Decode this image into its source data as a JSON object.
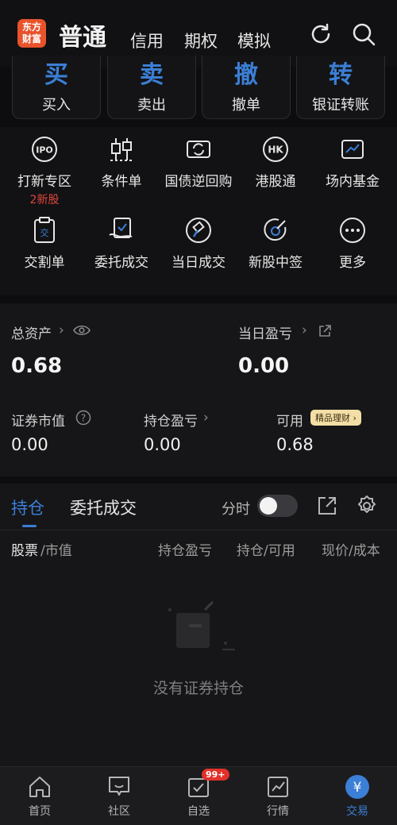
{
  "header": {
    "logo_text": "东方财富",
    "tabs": [
      "普通",
      "信用",
      "期权",
      "模拟"
    ]
  },
  "quick_actions": [
    {
      "glyph": "买",
      "label": "买入"
    },
    {
      "glyph": "卖",
      "label": "卖出"
    },
    {
      "glyph": "撤",
      "label": "撤单"
    },
    {
      "glyph": "转",
      "label": "银证转账"
    }
  ],
  "grid": [
    {
      "label": "打新专区",
      "badge": "2新股",
      "icon": "ipo-icon",
      "icon_text": "IPO"
    },
    {
      "label": "条件单",
      "icon": "condition-order-icon"
    },
    {
      "label": "国债逆回购",
      "icon": "reverse-repo-icon"
    },
    {
      "label": "港股通",
      "icon": "hk-stock-icon",
      "icon_text": "HK"
    },
    {
      "label": "场内基金",
      "icon": "etf-fund-icon"
    },
    {
      "label": "交割单",
      "icon": "settlement-icon",
      "icon_text": "交"
    },
    {
      "label": "委托成交",
      "icon": "order-deal-icon"
    },
    {
      "label": "当日成交",
      "icon": "today-deal-icon"
    },
    {
      "label": "新股中签",
      "icon": "ipo-win-icon"
    },
    {
      "label": "更多",
      "icon": "more-icon"
    }
  ],
  "assets": {
    "total_label": "总资产",
    "total_value": "0.68",
    "daily_pl_label": "当日盈亏",
    "daily_pl_value": "0.00",
    "market_value_label": "证券市值",
    "market_value": "0.00",
    "holding_pl_label": "持仓盈亏",
    "holding_pl_value": "0.00",
    "available_label": "可用",
    "available_value": "0.68",
    "promo_badge": "精品理财"
  },
  "positions": {
    "tab_holdings": "持仓",
    "tab_orders": "委托成交",
    "toggle_label": "分时",
    "col_stock": "股票",
    "col_market_value": "/市值",
    "col_holding_pl": "持仓盈亏",
    "col_position": "持仓/可用",
    "col_price": "现价/成本",
    "empty_text": "没有证券持仓"
  },
  "bottom_nav": [
    {
      "label": "首页",
      "icon": "home-icon"
    },
    {
      "label": "社区",
      "icon": "community-icon"
    },
    {
      "label": "自选",
      "icon": "watchlist-icon",
      "badge": "99+"
    },
    {
      "label": "行情",
      "icon": "market-icon"
    },
    {
      "label": "交易",
      "icon": "trade-icon",
      "active": true
    }
  ],
  "colors": {
    "accent": "#3b7fd6",
    "brand": "#e8532c",
    "alert": "#e0453a"
  }
}
